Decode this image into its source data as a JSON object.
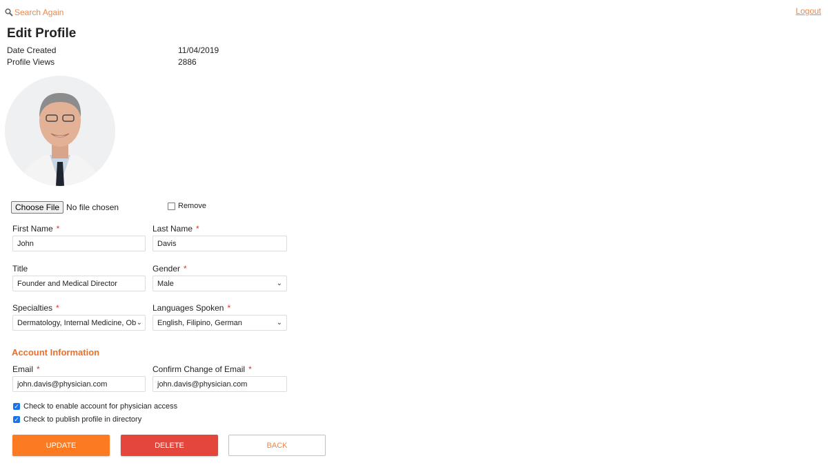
{
  "header": {
    "search_label": "Search Again",
    "search_icon": "magnifier-icon",
    "logout_label": "Logout"
  },
  "page": {
    "title": "Edit Profile"
  },
  "meta": [
    {
      "label": "Date Created",
      "value": "11/04/2019"
    },
    {
      "label": "Profile Views",
      "value": "2886"
    }
  ],
  "photo": {
    "choose_file_label": "Choose File",
    "file_status": "No file chosen",
    "remove_label": "Remove",
    "remove_checked": false
  },
  "form": {
    "first_name": {
      "label": "First Name",
      "value": "John",
      "required": "*"
    },
    "last_name": {
      "label": "Last Name",
      "value": "Davis",
      "required": "*"
    },
    "title": {
      "label": "Title",
      "value": "Founder and Medical Director"
    },
    "gender": {
      "label": "Gender",
      "value": "Male",
      "required": "*"
    },
    "specialties": {
      "label": "Specialties",
      "value": "Dermatology, Internal Medicine, Ob",
      "required": "*"
    },
    "languages": {
      "label": "Languages Spoken",
      "value": "English, Filipino, German",
      "required": "*"
    }
  },
  "account": {
    "heading": "Account Information",
    "email": {
      "label": "Email",
      "value": "john.davis@physician.com",
      "required": "*"
    },
    "confirm_email": {
      "label": "Confirm Change of Email",
      "value": "john.davis@physician.com",
      "required": "*"
    },
    "enable_access": {
      "label": "Check to enable account for physician access",
      "checked": true
    },
    "publish": {
      "label": "Check to publish profile in directory",
      "checked": true
    }
  },
  "buttons": {
    "update": "UPDATE",
    "delete": "DELETE",
    "back": "BACK"
  },
  "colors": {
    "accent": "#e8884a",
    "update": "#fb7a22",
    "delete": "#e5463b",
    "checkbox": "#1a73e8"
  }
}
